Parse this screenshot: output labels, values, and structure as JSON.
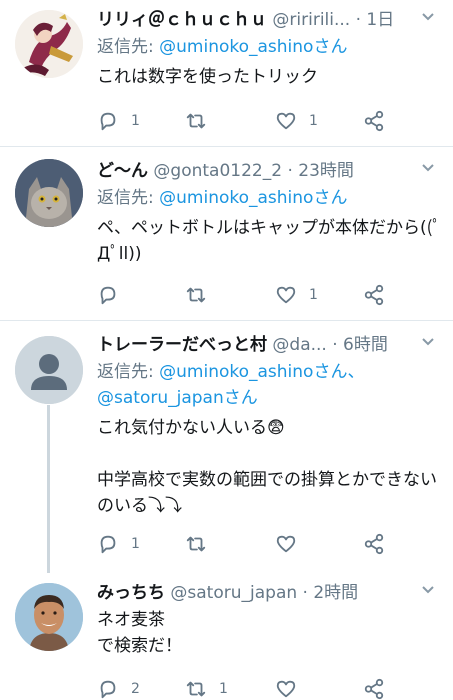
{
  "colors": {
    "accent": "#1b95e0",
    "muted": "#657786",
    "text": "#14171a",
    "divider": "#e1e8ed"
  },
  "tweets": [
    {
      "name": "リリィ＠ｃｈｕｃｈｕ",
      "handle": "@riririli...",
      "dot": "·",
      "time": "1日",
      "reply_prefix": "返信先: ",
      "reply_to": "@uminoko_ashinoさん",
      "text": "これは数字を使ったトリック",
      "reply_count": "1",
      "retweet_count": "",
      "like_count": "1"
    },
    {
      "name": "ど〜ん",
      "handle": "@gonta0122_2",
      "dot": "·",
      "time": "23時間",
      "reply_prefix": "返信先: ",
      "reply_to": "@uminoko_ashinoさん",
      "text": "ペ、ペットボトルはキャップが本体だから((ﾟДﾟll))",
      "reply_count": "",
      "retweet_count": "",
      "like_count": "1"
    },
    {
      "name": "トレーラーだべっと村",
      "handle": "@da...",
      "dot": "·",
      "time": "6時間",
      "reply_prefix": "返信先: ",
      "reply_to": "@uminoko_ashinoさん、",
      "reply_to_2": "@satoru_japanさん",
      "text": "これ気付かない人いる😨\n\n中学高校で実数の範囲での掛算とかできないのいる⤵︎⤵︎",
      "reply_count": "1",
      "retweet_count": "",
      "like_count": ""
    },
    {
      "name": "みっちち",
      "handle": "@satoru_japan",
      "dot": "·",
      "time": "2時間",
      "text": "ネオ麦茶\nで検索だ！",
      "reply_count": "2",
      "retweet_count": "1",
      "like_count": ""
    }
  ]
}
